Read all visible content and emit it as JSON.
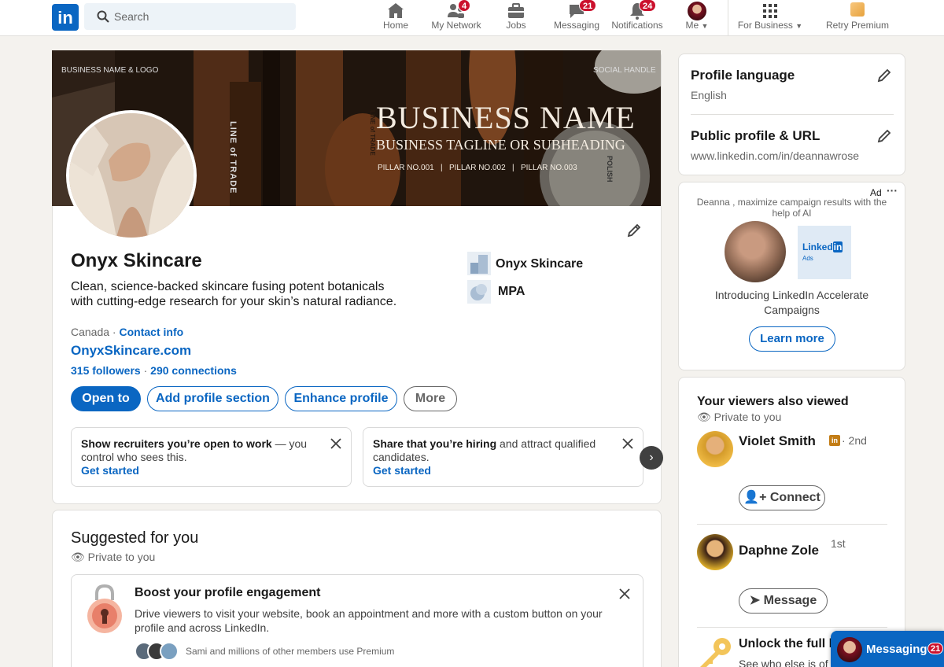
{
  "nav": {
    "logo": "in",
    "search_placeholder": "Search",
    "items": [
      {
        "label": "Home"
      },
      {
        "label": "My Network",
        "badge": "4"
      },
      {
        "label": "Jobs"
      },
      {
        "label": "Messaging",
        "badge": "21"
      },
      {
        "label": "Notifications",
        "badge": "24"
      },
      {
        "label": "Me"
      },
      {
        "label": "For Business"
      },
      {
        "label": "Retry Premium"
      }
    ]
  },
  "banner": {
    "top_left": "BUSINESS NAME & LOGO",
    "top_right": "SOCIAL HANDLE",
    "title": "BUSINESS NAME",
    "tagline": "BUSINESS TAGLINE OR SUBHEADING",
    "pillars": "PILLAR NO.001   |   PILLAR NO.002   |   PILLAR NO.003",
    "product_text_1": "LINE of TRADE",
    "product_text_2": "LINE of TRADE",
    "product_text_3": "POLISH"
  },
  "profile": {
    "name": "Onyx Skincare",
    "headline_1": "Clean, science-backed skincare fusing potent botanicals",
    "headline_2": "with cutting-edge research for your skin’s natural radiance.",
    "location": "Canada",
    "contact_info": "Contact info",
    "website": "OnyxSkincare.com",
    "followers": "315 followers",
    "connections": "290 connections",
    "company": "Onyx Skincare",
    "school": "MPA",
    "buttons": {
      "open_to": "Open to",
      "add_section": "Add profile section",
      "enhance": "Enhance profile",
      "more": "More"
    },
    "tips": [
      {
        "bold": "Show recruiters you’re open to work",
        "rest_1": " — you",
        "rest_2": "control who sees this.",
        "cta": "Get started"
      },
      {
        "bold": "Share that you’re hiring",
        "rest_1": " and attract qualified",
        "rest_2": "candidates.",
        "cta": "Get started"
      }
    ]
  },
  "suggested": {
    "title": "Suggested for you",
    "private": "Private to you",
    "boost_title": "Boost your profile engagement",
    "boost_desc_1": "Drive viewers to visit your website, book an appointment and more with a custom button on your",
    "boost_desc_2": "profile and across LinkedIn.",
    "boost_social": "Sami and millions of other members use Premium"
  },
  "sidebar": {
    "profile_language": "Profile language",
    "language": "English",
    "public_profile": "Public profile & URL",
    "url": "www.linkedin.com/in/deannawrose",
    "ad_label": "Ad",
    "ad_text_1": "Deanna , maximize campaign results with the",
    "ad_text_2": "help of AI",
    "ad_logo": "Linked",
    "ad_logo_in": "in",
    "ad_logo_sub": "Ads",
    "ad_headline_1": "Introducing LinkedIn Accelerate",
    "ad_headline_2": "Campaigns",
    "ad_cta": "Learn more",
    "viewers_title": "Your viewers also viewed",
    "viewers_private": "Private to you",
    "people": [
      {
        "name": "Violet Smith",
        "degree": "· 2nd",
        "action": "Connect"
      },
      {
        "name": "Daphne Zole",
        "degree": "1st",
        "action": "Message"
      }
    ],
    "unlock": "Unlock the full li",
    "unlock_sub": "See who else is of"
  },
  "messaging": {
    "label": "Messaging",
    "badge": "21"
  },
  "colors": {
    "brand": "#0a66c2",
    "badge": "#cb112d",
    "background": "#f4f2ee"
  }
}
